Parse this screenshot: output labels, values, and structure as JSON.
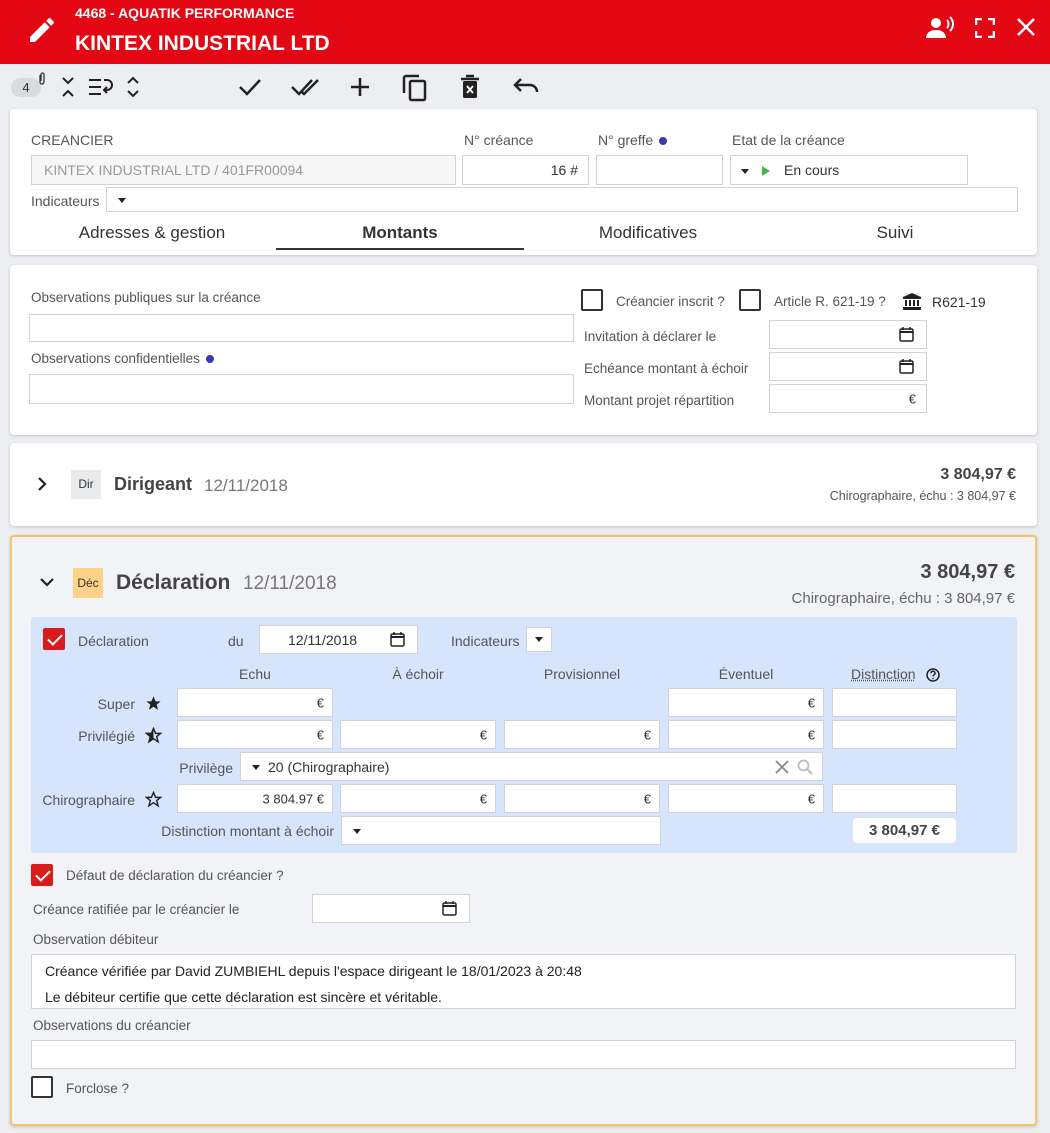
{
  "header": {
    "dossier": "4468 - AQUATIK PERFORMANCE",
    "title": "KINTEX INDUSTRIAL LTD"
  },
  "toolbar": {
    "attachments_count": "4"
  },
  "creancier": {
    "label": "CREANCIER",
    "value": "KINTEX INDUSTRIAL LTD / 401FR00094",
    "n_creance_label": "N° créance",
    "n_creance_value": "16 #",
    "n_greffe_label": "N° greffe",
    "etat_label": "Etat de la créance",
    "etat_value": "En cours",
    "indicateurs_label": "Indicateurs"
  },
  "tabs": [
    {
      "label": "Adresses & gestion"
    },
    {
      "label": "Montants"
    },
    {
      "label": "Modificatives"
    },
    {
      "label": "Suivi"
    }
  ],
  "montants": {
    "obs_publiques_label": "Observations publiques sur la créance",
    "obs_confidentielles_label": "Observations confidentielles",
    "creancier_inscrit_label": "Créancier inscrit ?",
    "article_label": "Article R. 621-19 ?",
    "r621_label": "R621-19",
    "invitation_label": "Invitation à déclarer le",
    "echeance_label": "Echéance montant à échoir",
    "projet_label": "Montant projet répartition",
    "euro": "€"
  },
  "dirigeant": {
    "badge": "Dir",
    "title": "Dirigeant",
    "date": "12/11/2018",
    "amount": "3 804,97 €",
    "sub": "Chirographaire, échu : 3 804,97 €"
  },
  "declaration": {
    "badge": "Déc",
    "title": "Déclaration",
    "date": "12/11/2018",
    "amount": "3 804,97 €",
    "sub": "Chirographaire, échu : 3 804,97 €",
    "check_label": "Déclaration",
    "du_label": "du",
    "du_value": "12/11/2018",
    "indicateurs_label": "Indicateurs",
    "columns": [
      "Echu",
      "À échoir",
      "Provisionnel",
      "Éventuel",
      "Distinction"
    ],
    "rows": {
      "super": "Super",
      "privilegie": "Privilégié",
      "privilege": "Privilège",
      "privilege_value": "20 (Chirographaire)",
      "chirographaire": "Chirographaire",
      "chiro_echu": "3 804.97 €"
    },
    "distinction_label": "Distinction montant à échoir",
    "total": "3 804,97 €",
    "defaut_label": "Défaut de déclaration du créancier ?",
    "ratifiee_label": "Créance ratifiée par le créancier le",
    "obs_debiteur_label": "Observation débiteur",
    "obs_debiteur_line1": "Créance vérifiée par David ZUMBIEHL depuis l'espace dirigeant le 18/01/2023 à 20:48",
    "obs_debiteur_line2": "Le débiteur certifie que cette déclaration est sincère et véritable.",
    "obs_creancier_label": "Observations du créancier",
    "forclose_label": "Forclose ?"
  },
  "colors": {
    "header": "#e30613",
    "accent_check": "#d81b1b",
    "declaration_border": "#f5c36b",
    "declaration_badge": "#ffd28a",
    "section_bg": "#d6e4fc"
  }
}
